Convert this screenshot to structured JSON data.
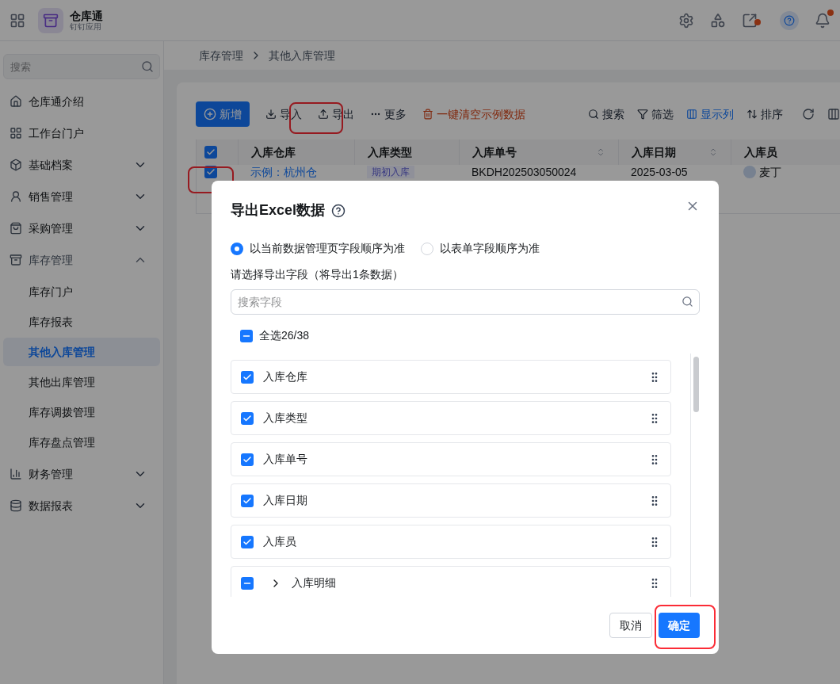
{
  "app": {
    "name": "仓库通",
    "subtitle": "钉钉应用"
  },
  "sidebar": {
    "search_placeholder": "搜索",
    "items": [
      {
        "label": "仓库通介绍"
      },
      {
        "label": "工作台门户"
      },
      {
        "label": "基础档案",
        "expanded": false
      },
      {
        "label": "销售管理",
        "expanded": false
      },
      {
        "label": "采购管理",
        "expanded": false
      },
      {
        "label": "库存管理",
        "expanded": true,
        "children": [
          {
            "label": "库存门户",
            "selected": false
          },
          {
            "label": "库存报表",
            "selected": false
          },
          {
            "label": "其他入库管理",
            "selected": true
          },
          {
            "label": "其他出库管理",
            "selected": false
          },
          {
            "label": "库存调拨管理",
            "selected": false
          },
          {
            "label": "库存盘点管理",
            "selected": false
          }
        ]
      },
      {
        "label": "财务管理",
        "expanded": false
      },
      {
        "label": "数据报表",
        "expanded": false
      }
    ]
  },
  "breadcrumb": [
    "库存管理",
    "其他入库管理"
  ],
  "toolbar": {
    "new": "新增",
    "left": [
      {
        "kind": "import",
        "label": "导入"
      },
      {
        "kind": "export",
        "label": "导出"
      },
      {
        "kind": "more",
        "label": "更多"
      },
      {
        "kind": "clear",
        "label": "一键清空示例数据"
      }
    ],
    "right": [
      {
        "kind": "search",
        "label": "搜索"
      },
      {
        "kind": "filter",
        "label": "筛选"
      },
      {
        "kind": "columns",
        "label": "显示列"
      },
      {
        "kind": "sort",
        "label": "排序"
      }
    ]
  },
  "table": {
    "all_checked": true,
    "columns": [
      {
        "label": "入库仓库",
        "sortable": false
      },
      {
        "label": "入库类型",
        "sortable": false
      },
      {
        "label": "入库单号",
        "sortable": true
      },
      {
        "label": "入库日期",
        "sortable": true
      },
      {
        "label": "入库员",
        "sortable": false
      }
    ],
    "rows": [
      {
        "checked": true,
        "warehouse": "示例：杭州仓",
        "type": "期初入库",
        "number": "BKDH202503050024",
        "date": "2025-03-05",
        "operator": "麦丁"
      }
    ]
  },
  "dialog": {
    "title": "导出Excel数据",
    "options": [
      {
        "label": "以当前数据管理页字段顺序为准",
        "selected": true
      },
      {
        "label": "以表单字段顺序为准",
        "selected": false
      }
    ],
    "hint": "请选择导出字段（将导出1条数据）",
    "search_placeholder": "搜索字段",
    "select_all": {
      "label": "全选26/38",
      "checked": true,
      "indeterminate": true
    },
    "fields": [
      {
        "label": "入库仓库",
        "checked": true,
        "indeterminate": false,
        "expandable": false
      },
      {
        "label": "入库类型",
        "checked": true,
        "indeterminate": false,
        "expandable": false
      },
      {
        "label": "入库单号",
        "checked": true,
        "indeterminate": false,
        "expandable": false
      },
      {
        "label": "入库日期",
        "checked": true,
        "indeterminate": false,
        "expandable": false
      },
      {
        "label": "入库员",
        "checked": true,
        "indeterminate": false,
        "expandable": false
      },
      {
        "label": "入库明细",
        "checked": true,
        "indeterminate": true,
        "expandable": true
      }
    ],
    "buttons": [
      {
        "label": "取消",
        "primary": false
      },
      {
        "label": "确定",
        "primary": true
      }
    ]
  }
}
